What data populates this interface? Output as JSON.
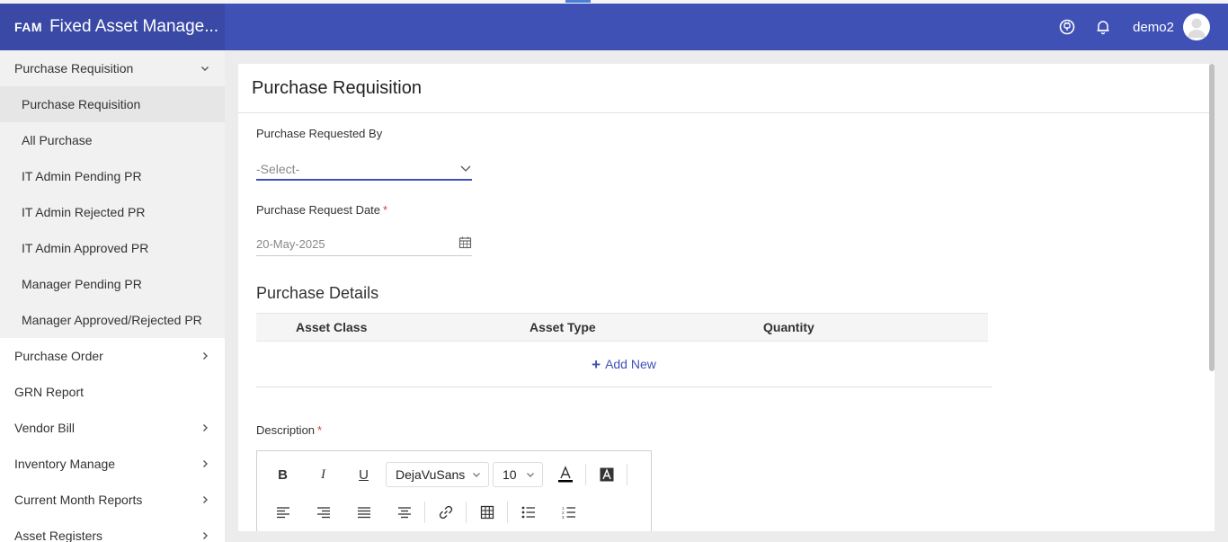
{
  "header": {
    "abbr": "FAM",
    "title": "Fixed Asset Manage...",
    "username": "demo2",
    "colors": {
      "primary": "#3f51b5",
      "brand_bg": "#3949a5"
    }
  },
  "sidebar": {
    "items": [
      {
        "label": "Purchase Requisition",
        "expanded": true,
        "children": [
          {
            "label": "Purchase Requisition",
            "active": true
          },
          {
            "label": "All Purchase"
          },
          {
            "label": "IT Admin Pending PR"
          },
          {
            "label": "IT Admin Rejected PR"
          },
          {
            "label": "IT Admin Approved PR"
          },
          {
            "label": "Manager Pending PR"
          },
          {
            "label": "Manager Approved/Rejected PR"
          }
        ]
      },
      {
        "label": "Purchase Order",
        "has_children": true
      },
      {
        "label": "GRN Report"
      },
      {
        "label": "Vendor Bill",
        "has_children": true
      },
      {
        "label": "Inventory Manage",
        "has_children": true
      },
      {
        "label": "Current Month Reports",
        "has_children": true
      },
      {
        "label": "Asset Registers",
        "has_children": true
      }
    ]
  },
  "main": {
    "page_title": "Purchase Requisition",
    "requested_by": {
      "label": "Purchase Requested By",
      "value": "-Select-"
    },
    "request_date": {
      "label": "Purchase Request Date",
      "required_mark": "*",
      "value": "20-May-2025"
    },
    "details": {
      "title": "Purchase Details",
      "columns": [
        "Asset Class",
        "Asset Type",
        "Quantity"
      ],
      "add_new": "Add New"
    },
    "description": {
      "label": "Description",
      "required_mark": "*",
      "toolbar": {
        "bold": "B",
        "italic": "I",
        "underline": "U",
        "font_family": "DejaVuSans",
        "font_size": "10"
      }
    }
  }
}
